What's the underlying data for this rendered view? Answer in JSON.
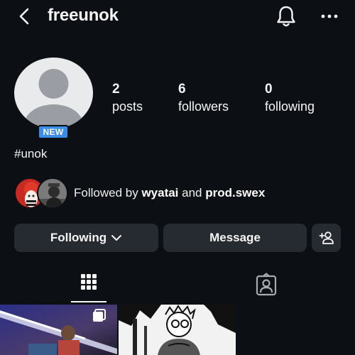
{
  "header": {
    "username": "freeunok",
    "back_icon": "chevron-left-icon",
    "bell_icon": "bell-icon",
    "more_icon": "more-horizontal-icon"
  },
  "profile": {
    "badge": "NEW",
    "stats": [
      {
        "value": "2",
        "label": "posts"
      },
      {
        "value": "6",
        "label": "followers"
      },
      {
        "value": "0",
        "label": "following"
      }
    ],
    "bio": "#unok"
  },
  "followed_by": {
    "prefix": "Followed by ",
    "user1": "wyatai",
    "conj": " and ",
    "user2": "prod.swex"
  },
  "actions": {
    "following_label": "Following",
    "message_label": "Message"
  },
  "tabs": {
    "active": "grid"
  },
  "colors": {
    "background": "#0c0f14",
    "button": "#262a31",
    "badge": "#3b8ee8"
  }
}
